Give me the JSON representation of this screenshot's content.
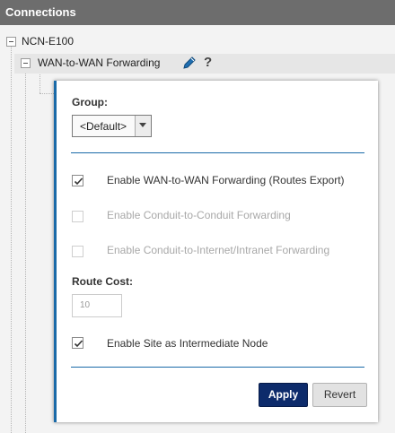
{
  "header": {
    "title": "Connections"
  },
  "tree": {
    "root_label": "NCN-E100",
    "child_label": "WAN-to-WAN Forwarding",
    "edit_icon": "pencil-icon",
    "help_label": "?"
  },
  "panel": {
    "group_label": "Group:",
    "group_value": "<Default>",
    "checkboxes": [
      {
        "label": "Enable WAN-to-WAN Forwarding (Routes Export)",
        "checked": true,
        "enabled": true
      },
      {
        "label": "Enable Conduit-to-Conduit Forwarding",
        "checked": false,
        "enabled": false
      },
      {
        "label": "Enable Conduit-to-Internet/Intranet Forwarding",
        "checked": false,
        "enabled": false
      }
    ],
    "route_cost_label": "Route Cost:",
    "route_cost_value": "10",
    "intermediate_node": {
      "label": "Enable Site as Intermediate Node",
      "checked": true,
      "enabled": true
    },
    "apply_label": "Apply",
    "revert_label": "Revert"
  },
  "colors": {
    "header_bg": "#6d6d6d",
    "panel_accent": "#1a6aa8",
    "apply_bg": "#0d2b6b"
  }
}
